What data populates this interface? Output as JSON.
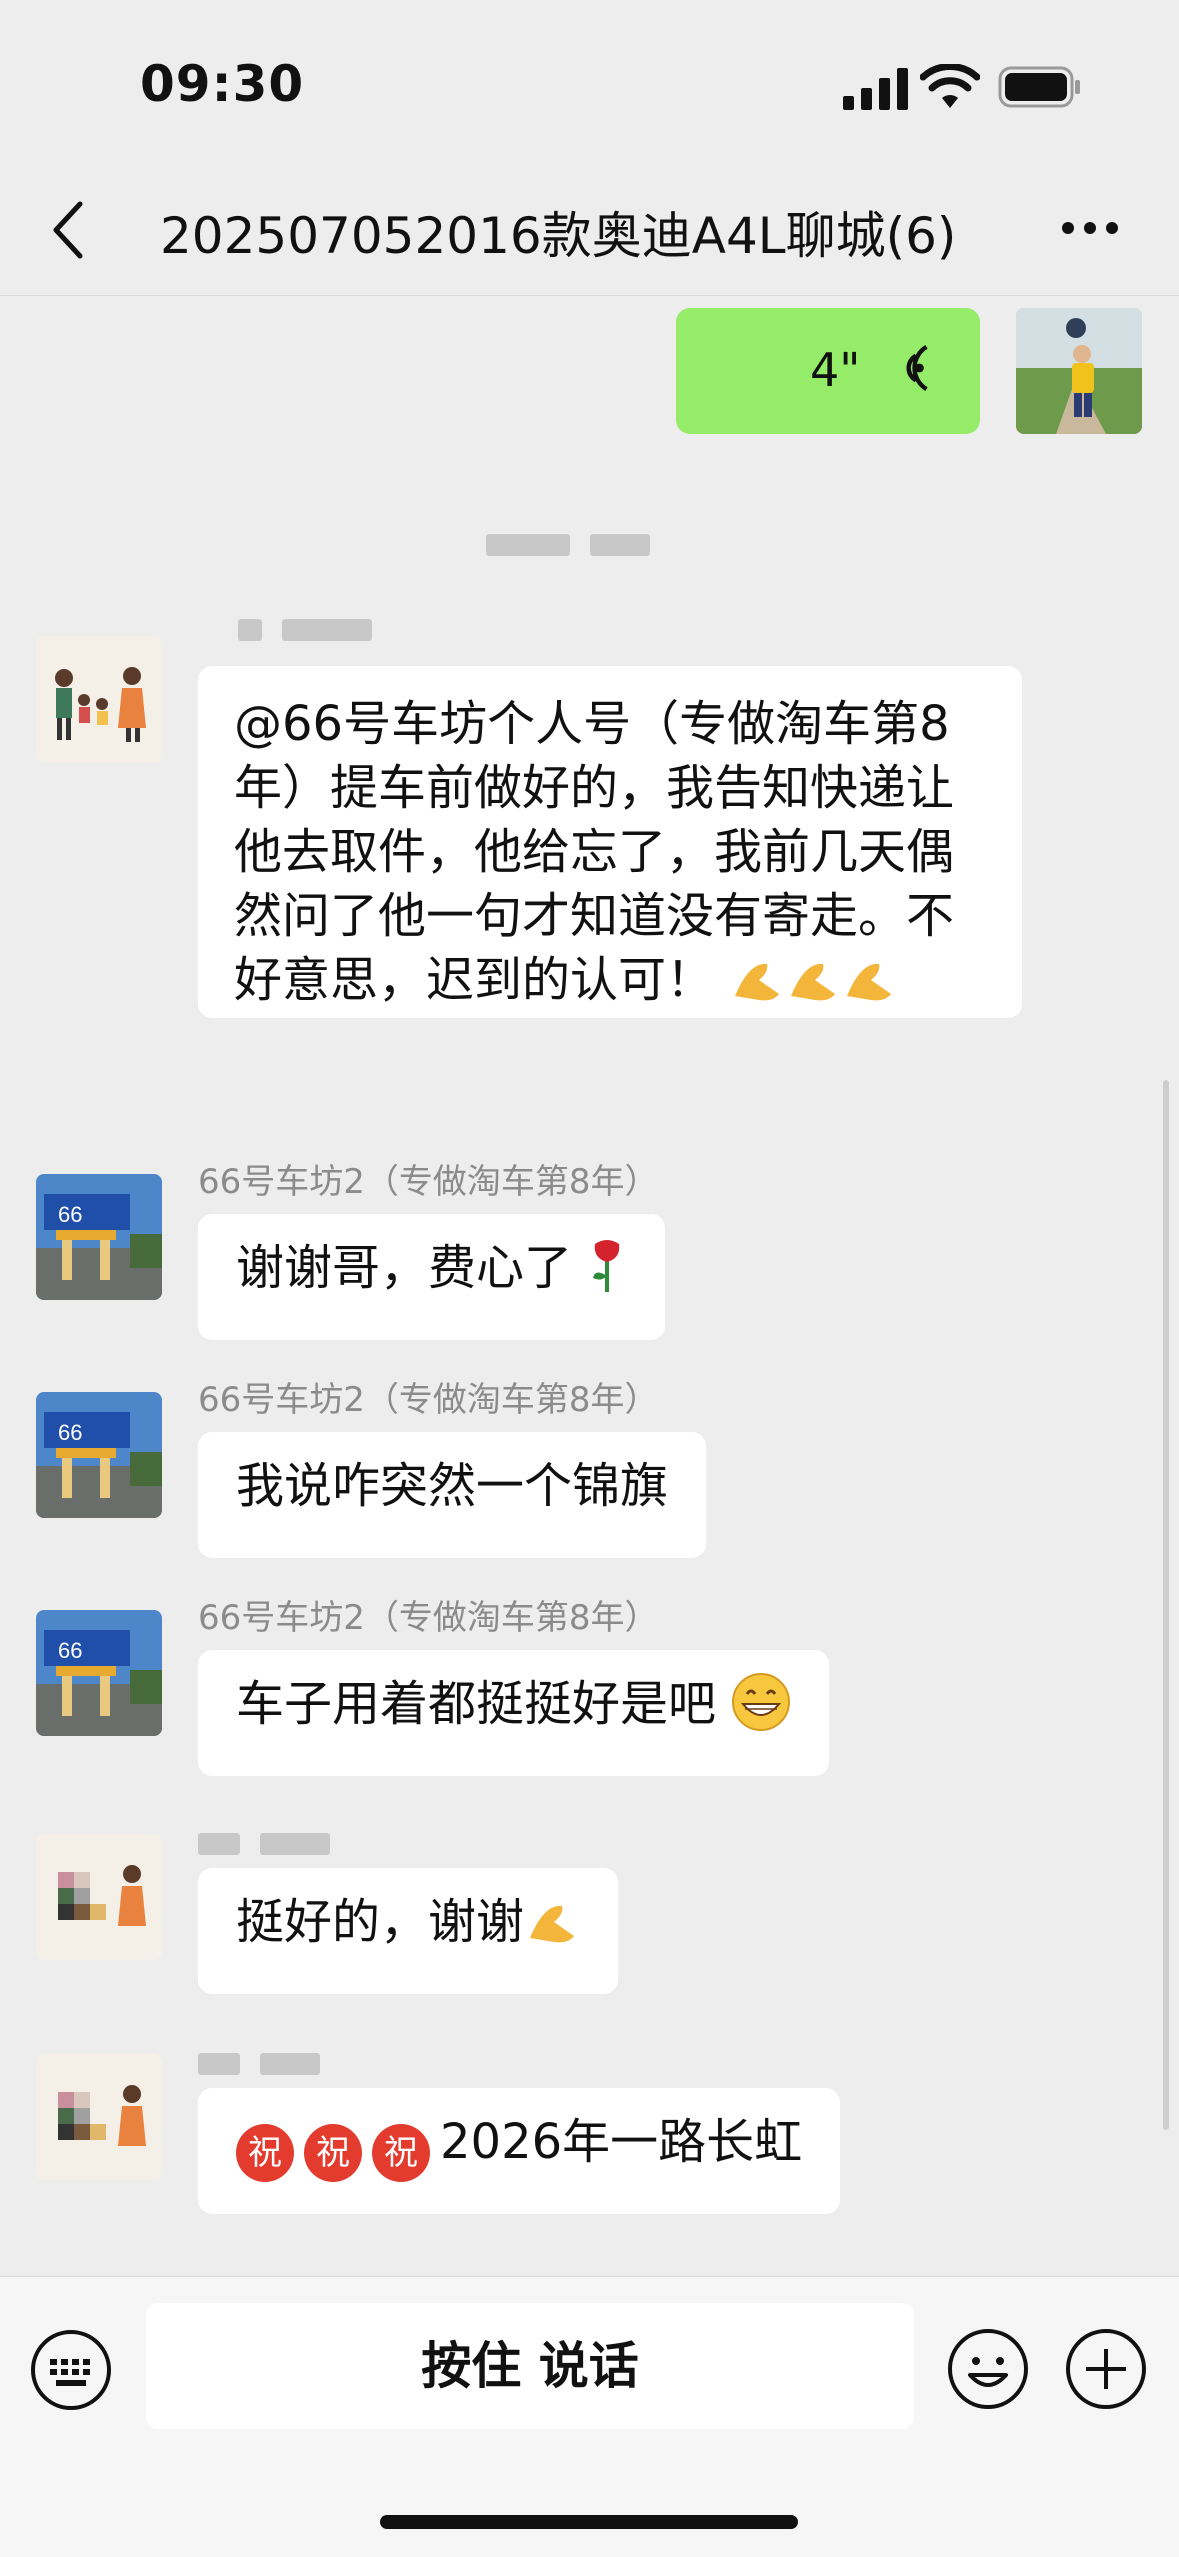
{
  "status_bar": {
    "time": "09:30"
  },
  "nav": {
    "title": "202507052016款奥迪A4L聊城(6)"
  },
  "messages": {
    "voice": {
      "duration": "4\""
    },
    "m1": {
      "text": "@66号车坊个人号（专做淘车第8年）提车前做好的，我告知快递让他去取件，他给忘了，我前几天偶然问了他一句才知道没有寄走。不好意思，迟到的认可！"
    },
    "m2": {
      "sender": "66号车坊2（专做淘车第8年）",
      "text": "谢谢哥，费心了"
    },
    "m3": {
      "sender": "66号车坊2（专做淘车第8年）",
      "text": "我说咋突然一个锦旗"
    },
    "m4": {
      "sender": "66号车坊2（专做淘车第8年）",
      "text": "车子用着都挺挺好是吧"
    },
    "m5": {
      "text": "挺好的，谢谢"
    },
    "m6": {
      "zhu": "祝",
      "text": "2026年一路长虹"
    }
  },
  "bottom_bar": {
    "talk_label": "按住 说话"
  },
  "colors": {
    "green_bubble": "#95ec69",
    "background": "#ededed",
    "zhu_red": "#e33b2e"
  }
}
